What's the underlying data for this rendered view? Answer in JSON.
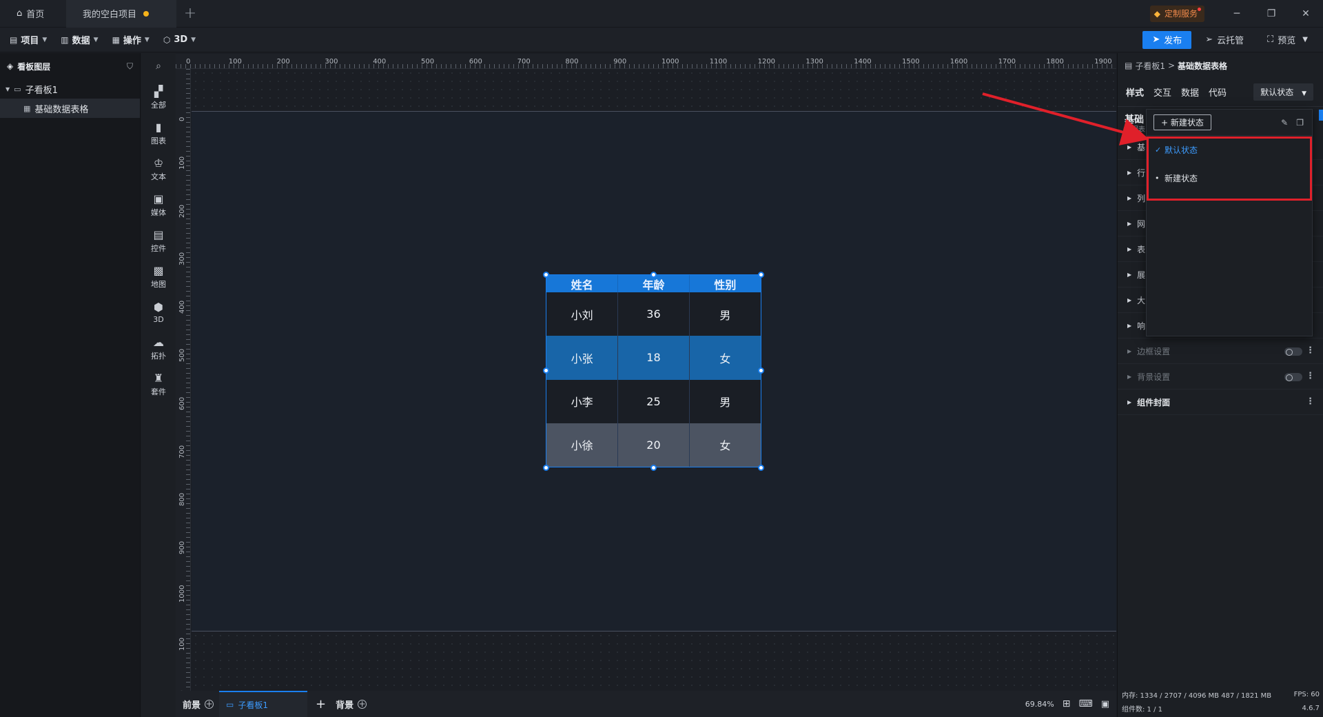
{
  "titlebar": {
    "home_tab": "首页",
    "project_tab": "我的空白项目",
    "add_tab": "+",
    "custom_service": "定制服务",
    "minimize": "─",
    "restore": "❐",
    "close": "✕"
  },
  "toolbar": {
    "items": [
      "项目",
      "数据",
      "操作",
      "3D"
    ],
    "publish": "发布",
    "cloud": "云托管",
    "preview": "预览"
  },
  "layers": {
    "title": "看板图层",
    "parent": "子看板1",
    "child": "基础数据表格"
  },
  "components": {
    "items": [
      "全部",
      "图表",
      "文本",
      "媒体",
      "控件",
      "地图",
      "3D",
      "拓扑",
      "套件"
    ]
  },
  "ruler": {
    "h_labels": [
      "0",
      "100",
      "200",
      "300",
      "400",
      "500",
      "600",
      "700",
      "800",
      "900",
      "1000",
      "1100",
      "1200",
      "1300",
      "1400",
      "1500",
      "1600",
      "1700",
      "1800",
      "1900"
    ],
    "v_labels": [
      "0",
      "100",
      "200",
      "300",
      "400",
      "500",
      "600",
      "700",
      "800",
      "900",
      "1000",
      "100",
      "00"
    ]
  },
  "table": {
    "headers": [
      "姓名",
      "年龄",
      "性别"
    ],
    "rows": [
      [
        "小刘",
        "36",
        "男"
      ],
      [
        "小张",
        "18",
        "女"
      ],
      [
        "小李",
        "25",
        "男"
      ],
      [
        "小徐",
        "20",
        "女"
      ]
    ]
  },
  "bottombar": {
    "foreground": "前景",
    "tab": "子看板1",
    "add": "+",
    "background": "背景",
    "zoom": "69.84%"
  },
  "rpanel": {
    "breadcrumb_parent": "子看板1",
    "breadcrumb_sep": ">",
    "breadcrumb_current": "基础数据表格",
    "tabs": [
      "样式",
      "交互",
      "数据",
      "代码"
    ],
    "state_select": "默认状态",
    "title_partial": "基础",
    "sub_partial": "数据表",
    "sections": [
      "基",
      "行",
      "列",
      "网",
      "表",
      "展",
      "大",
      "响"
    ],
    "border_setting": "边框设置",
    "bg_setting": "背景设置",
    "cover": "组件封面",
    "memory": "内存: 1334 / 2707 / 4096 MB 487 / 1821 MB",
    "fps": "FPS: 60",
    "count": "组件数: 1 / 1",
    "version": "4.6.7"
  },
  "dropdown": {
    "new_button": "+ 新建状态",
    "items": [
      "默认状态",
      "新建状态"
    ]
  },
  "colors": {
    "accent": "#1a7ff0",
    "highlight": "#e0202a"
  }
}
